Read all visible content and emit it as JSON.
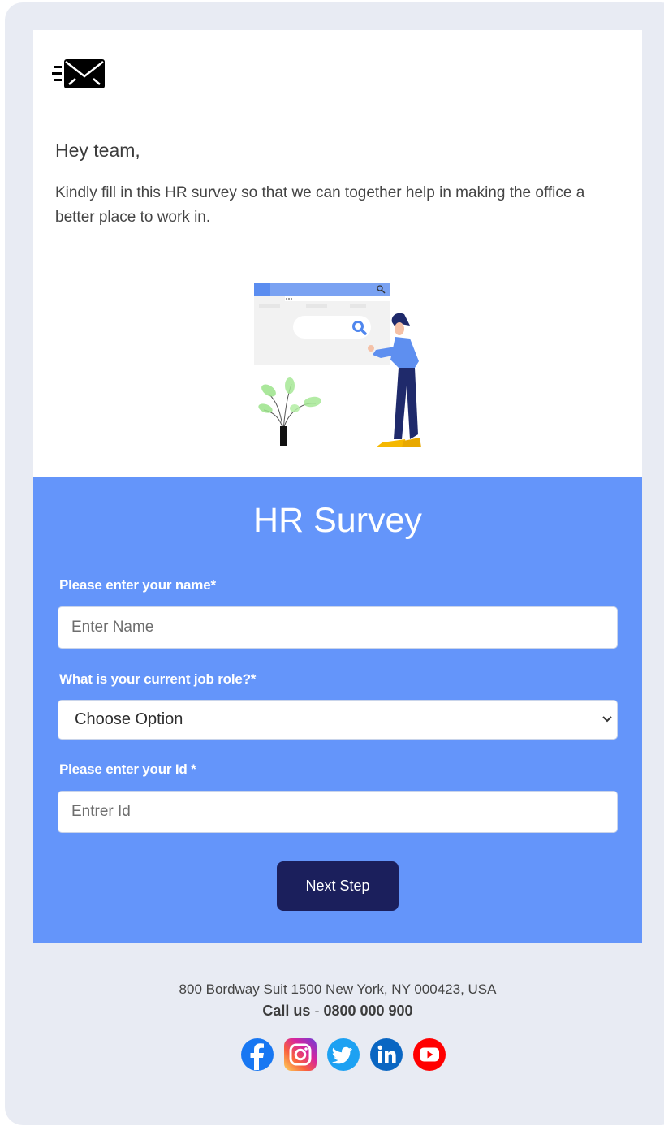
{
  "header": {
    "logo_icon": "envelope-fast-icon"
  },
  "intro": {
    "greeting": "Hey team,",
    "message": "Kindly fill in this HR survey so that we can together help in making the office a  better place to work in.",
    "illustration": "person-searching-browser-illustration"
  },
  "survey": {
    "title": "HR Survey",
    "fields": [
      {
        "label": "Please enter your name*",
        "placeholder": "Enter Name",
        "value": ""
      },
      {
        "label": "What is your current job role?*",
        "selected_option": "Choose Option",
        "icon": "chevron-down-icon"
      },
      {
        "label": "Please enter your Id *",
        "placeholder": "Entrer Id",
        "value": ""
      }
    ],
    "submit_label": "Next Step"
  },
  "footer": {
    "address": "800 Bordway Suit 1500 New York, NY 000423, USA",
    "call_label": "Call us",
    "call_separator": " - ",
    "phone": "0800 000 900",
    "socials": [
      {
        "name": "facebook",
        "icon": "facebook-icon",
        "color": "#1877f2"
      },
      {
        "name": "instagram",
        "icon": "instagram-icon",
        "color": "#d6249f"
      },
      {
        "name": "twitter",
        "icon": "twitter-icon",
        "color": "#1da1f2"
      },
      {
        "name": "linkedin",
        "icon": "linkedin-icon",
        "color": "#0a66c2"
      },
      {
        "name": "youtube",
        "icon": "youtube-icon",
        "color": "#ff0000"
      }
    ]
  },
  "colors": {
    "page_background": "#e8ebf3",
    "survey_background": "#6495fa",
    "button_background": "#1b1f5c"
  }
}
